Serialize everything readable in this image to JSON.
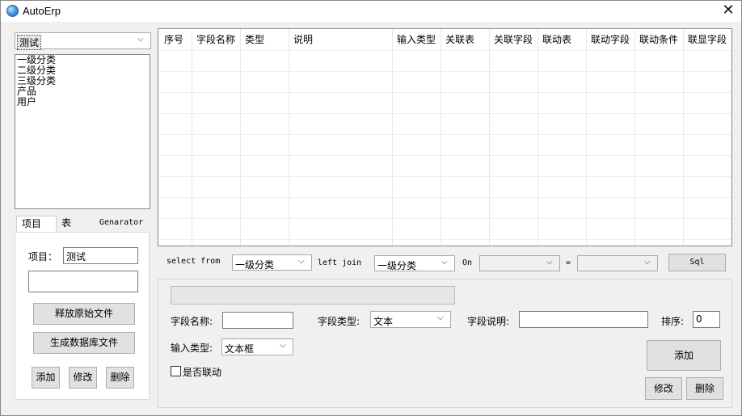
{
  "window": {
    "title": "AutoErp",
    "close_glyph": "✕"
  },
  "left": {
    "project_select": "测试",
    "list_items": [
      "一级分类",
      "二级分类",
      "三级分类",
      "产品",
      "用户"
    ],
    "tabs": [
      {
        "label": "项目"
      },
      {
        "label": "表"
      },
      {
        "label": "Genarator"
      }
    ],
    "project_label": "项目：",
    "project_value": "测试",
    "second_value": "",
    "release_button": "释放原始文件",
    "generate_button": "生成数据库文件",
    "add_button": "添加",
    "edit_button": "修改",
    "delete_button": "删除"
  },
  "grid": {
    "columns": [
      "序号",
      "字段名称",
      "类型",
      "说明",
      "输入类型",
      "关联表",
      "关联字段",
      "联动表",
      "联动字段",
      "联动条件",
      "联显字段"
    ]
  },
  "sql": {
    "select_from_label": "select from",
    "from_table": "一级分类",
    "left_join_label": "left join",
    "join_table": "一级分类",
    "on_label": "On",
    "on_left": "",
    "eq_label": "=",
    "on_right": "",
    "sql_button": "Sql"
  },
  "form": {
    "progress_value": "",
    "field_name_label": "字段名称:",
    "field_name_value": "",
    "field_type_label": "字段类型:",
    "field_type_value": "文本",
    "field_desc_label": "字段说明:",
    "field_desc_value": "",
    "sort_label": "排序:",
    "sort_value": "0",
    "input_type_label": "输入类型:",
    "input_type_value": "文本框",
    "linked_label": "是否联动",
    "linked_checked": false,
    "add_button": "添加",
    "edit_button": "修改",
    "delete_button": "删除"
  }
}
